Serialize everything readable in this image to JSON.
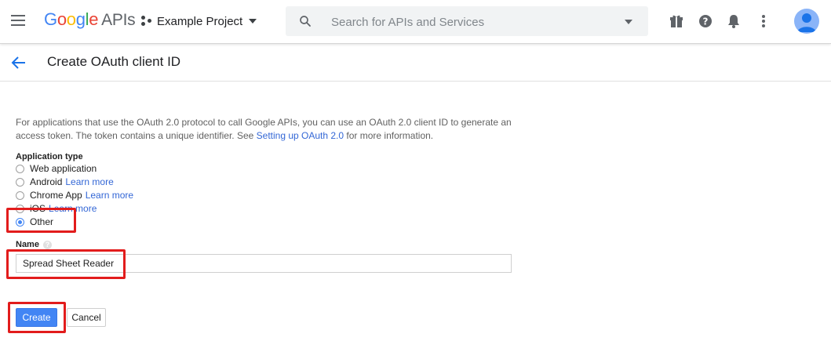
{
  "topbar": {
    "brand": {
      "g": "G",
      "o1": "o",
      "o2": "o",
      "g2": "g",
      "l": "l",
      "e": "e",
      "apis": "APIs"
    },
    "project_name": "Example Project",
    "search_placeholder": "Search for APIs and Services"
  },
  "subheader": {
    "title": "Create OAuth client ID"
  },
  "content": {
    "intro_part1": "For applications that use the OAuth 2.0 protocol to call Google APIs, you can use an OAuth 2.0 client ID to generate an access token. The token contains a unique identifier. See ",
    "intro_link": "Setting up OAuth 2.0",
    "intro_part2": " for more information.",
    "app_type_label": "Application type",
    "options": [
      {
        "label": "Web application",
        "link": "",
        "checked": false
      },
      {
        "label": "Android",
        "link": "Learn more",
        "checked": false
      },
      {
        "label": "Chrome App",
        "link": "Learn more",
        "checked": false
      },
      {
        "label": "iOS",
        "link": "Learn more",
        "checked": false
      },
      {
        "label": "Other",
        "link": "",
        "checked": true
      }
    ],
    "name_label": "Name",
    "help_glyph": "?",
    "name_value": "Spread Sheet Reader",
    "create_label": "Create",
    "cancel_label": "Cancel"
  },
  "colors": {
    "accent": "#4285f4",
    "link": "#3367d6",
    "highlight": "#e21c1c"
  }
}
